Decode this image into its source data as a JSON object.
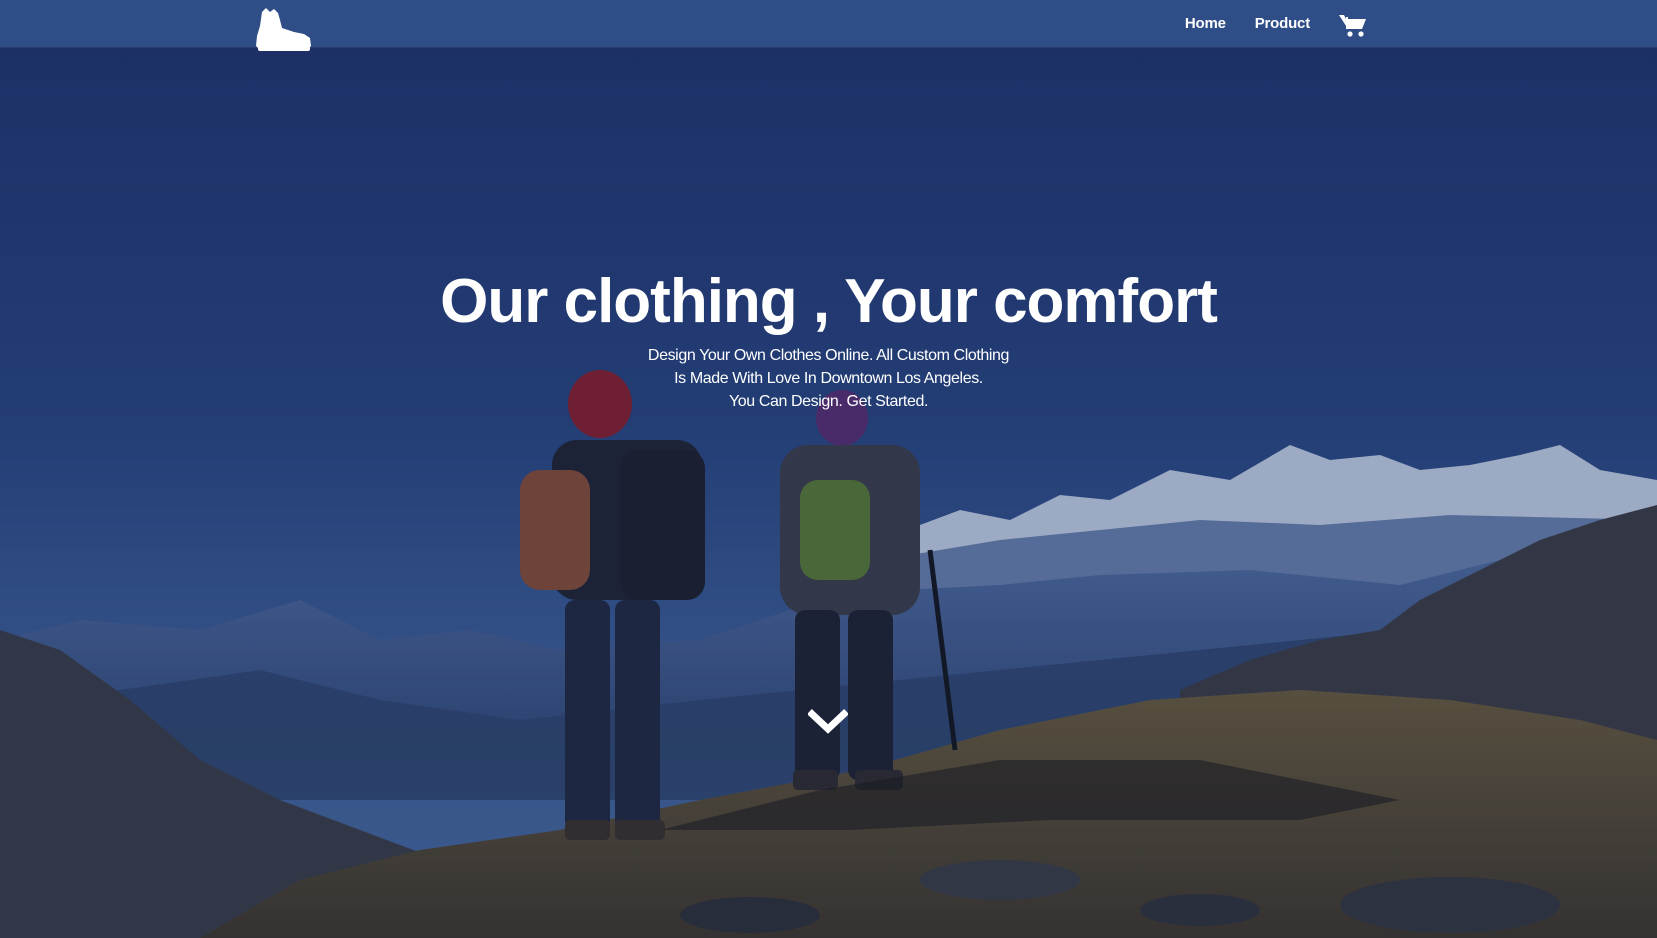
{
  "nav": {
    "logo_icon": "hiking-boot-icon",
    "links": [
      {
        "label": "Home"
      },
      {
        "label": "Product"
      }
    ],
    "cart_icon": "shopping-cart-icon"
  },
  "hero": {
    "title": "Our clothing , Your comfort",
    "subtitle_lines": [
      "Design Your Own Clothes Online. All Custom Clothing",
      "Is Made With Love In Downtown Los Angeles.",
      "You Can Design. Get Started."
    ],
    "scroll_icon": "chevron-down-icon",
    "background_description_icon": "mountain-hikers-photo"
  },
  "colors": {
    "navbar": "#2f4d86",
    "sky_top": "#1e3568",
    "sky_bottom": "#3a5a8f",
    "text": "#ffffff"
  }
}
